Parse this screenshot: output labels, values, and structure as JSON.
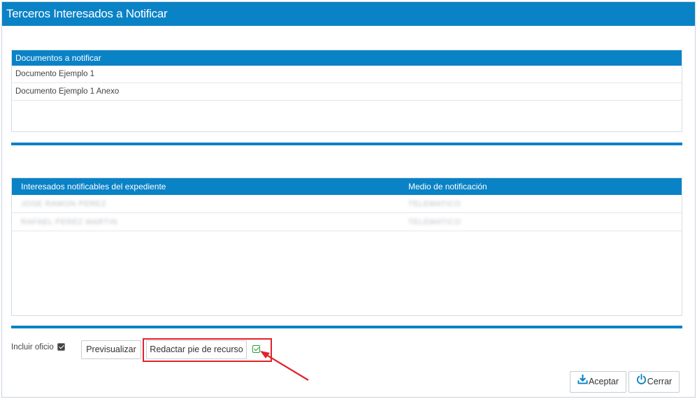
{
  "window": {
    "title": "Terceros Interesados a Notificar"
  },
  "documentos": {
    "header": "Documentos a notificar",
    "rows": [
      "Documento Ejemplo 1",
      "Documento Ejemplo 1 Anexo"
    ]
  },
  "interesados": {
    "columns": [
      "Interesados notificables del expediente",
      "Medio de notificación"
    ],
    "rows": [
      {
        "nombre": "JOSE RAMON PEREZ",
        "medio": "TELEMATICO"
      },
      {
        "nombre": "RAFAEL PEREZ MARTIN",
        "medio": "TELEMATICO"
      }
    ]
  },
  "options": {
    "incluir_oficio_label": "Incluir oficio",
    "incluir_oficio_checked": true,
    "previsualizar_label": "Previsualizar",
    "redactar_label": "Redactar pie de recurso",
    "redactar_checked": true
  },
  "footer": {
    "aceptar_label": "Aceptar",
    "cerrar_label": "Cerrar"
  },
  "colors": {
    "accent": "#0a82c6",
    "highlight": "#e0232a",
    "check_green": "#1ea23a"
  },
  "icons": {
    "aceptar": "download-icon",
    "cerrar": "power-icon"
  }
}
